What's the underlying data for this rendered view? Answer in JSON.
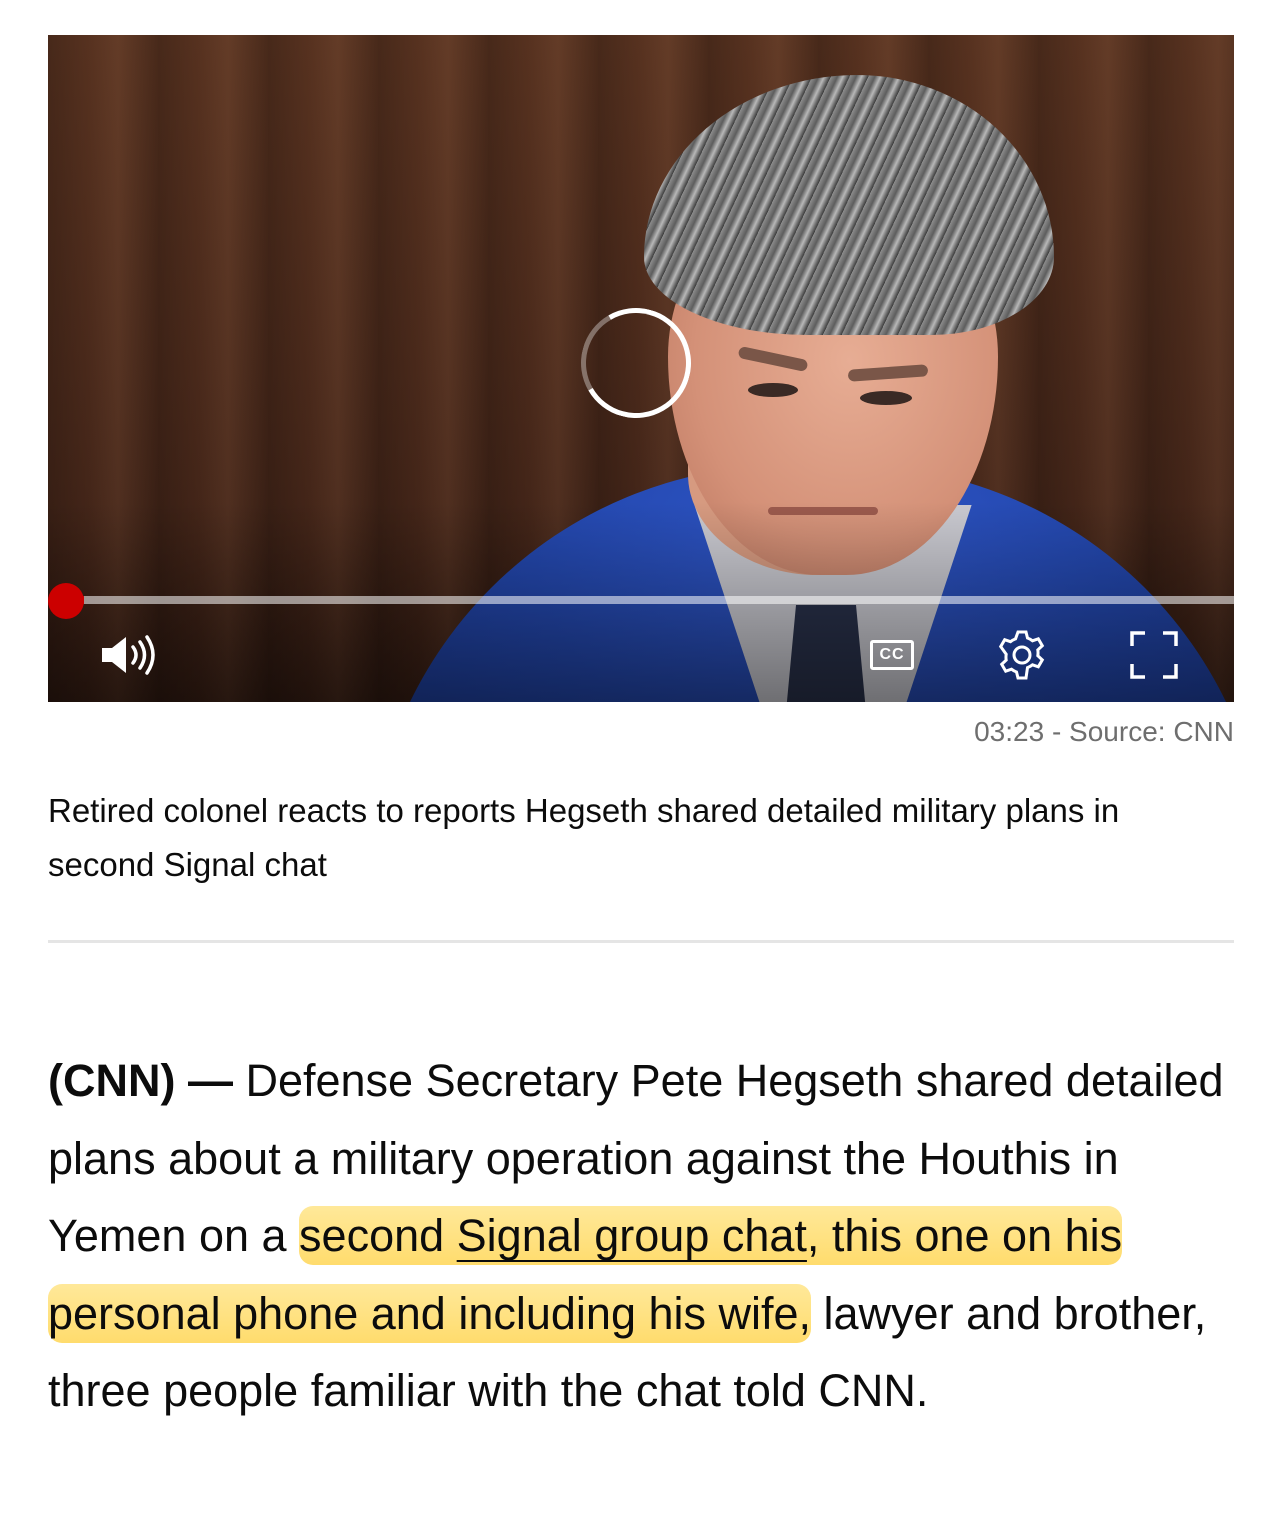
{
  "video": {
    "progress_percent": 1.5,
    "icons": {
      "volume": "volume-icon",
      "captions": "closed-captions-icon",
      "settings": "gear-icon",
      "fullscreen": "fullscreen-icon",
      "loading": "loading-spinner-icon"
    },
    "cc_label": "CC",
    "meta": "03:23 - Source: CNN",
    "caption": "Retired colonel reacts to reports Hegseth shared detailed military plans in second Signal chat"
  },
  "article": {
    "dateline": "(CNN) —",
    "text_1": " Defense Secretary Pete Hegseth shared detailed plans about a military operation against the Houthis in Yemen on a ",
    "highlight_1": "second ",
    "link": "Signal group chat",
    "highlight_2": ", this one on his personal phone and including his wife,",
    "text_2": " lawyer and brother, three people familiar with the chat told CNN.",
    "highlight_color": "#ffd246"
  },
  "colors": {
    "accent_red": "#cc0000",
    "meta_gray": "#6e6e6e",
    "divider": "#e5e5e5"
  }
}
